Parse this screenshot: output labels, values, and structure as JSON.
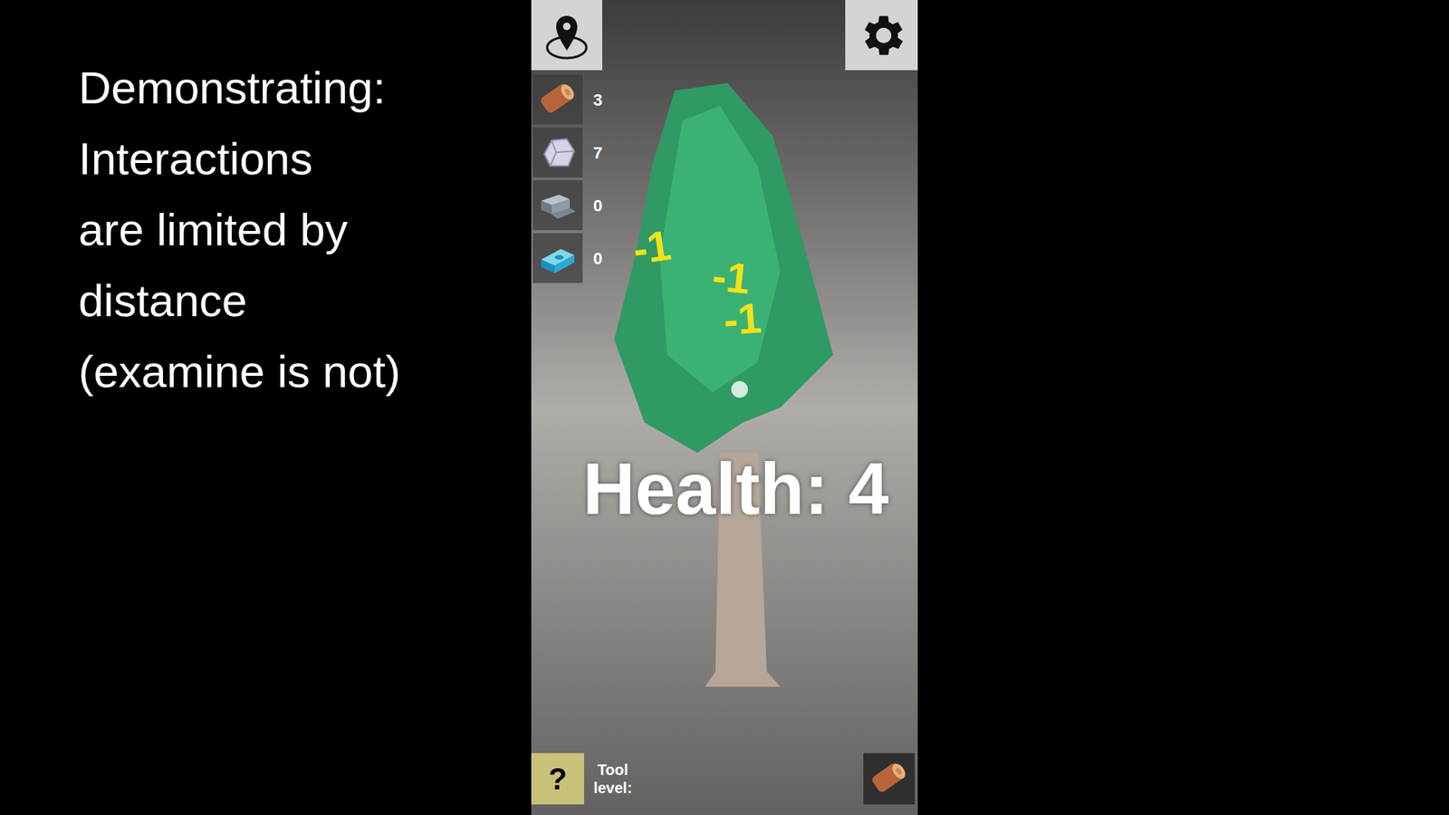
{
  "caption": {
    "lines": [
      "Demonstrating:",
      "Interactions",
      "are limited by",
      "distance",
      "(examine is not)"
    ]
  },
  "resources": [
    {
      "kind": "wood",
      "count": "3"
    },
    {
      "kind": "stone",
      "count": "7"
    },
    {
      "kind": "iron",
      "count": "0"
    },
    {
      "kind": "crystal",
      "count": "0"
    }
  ],
  "damage_popups": [
    {
      "text": "-1"
    },
    {
      "text": "-1"
    },
    {
      "text": "-1"
    }
  ],
  "target": {
    "health_text": "Health: 4"
  },
  "toolbar": {
    "help": "?",
    "tool_level": "Tool level:",
    "held_item": "wood"
  }
}
